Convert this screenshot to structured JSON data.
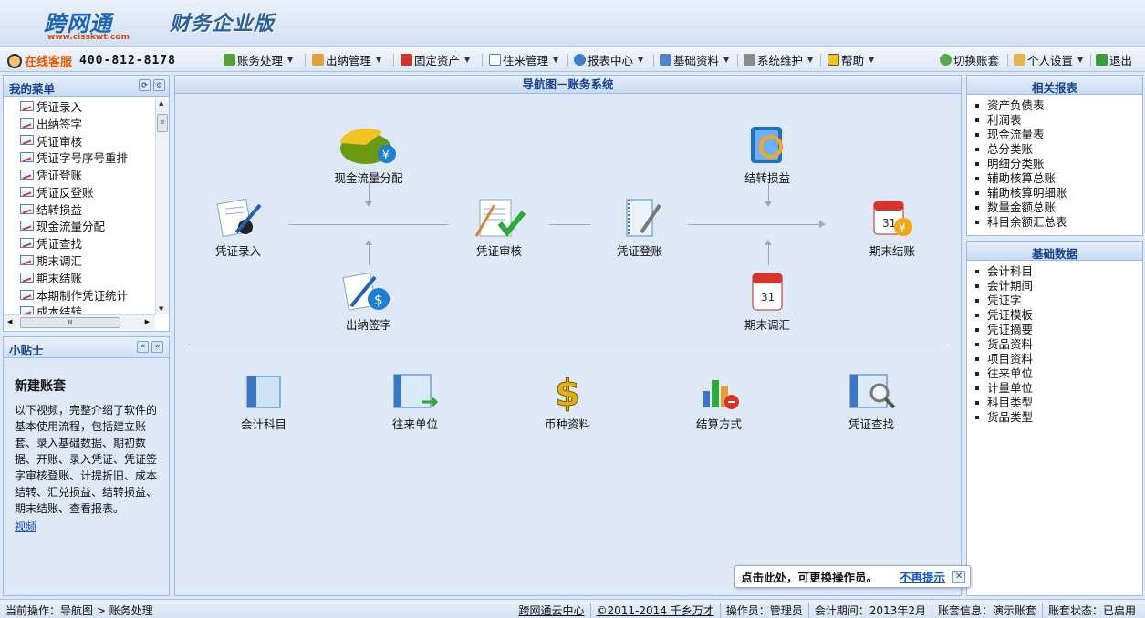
{
  "header": {
    "logo_text": "跨网通",
    "logo_url": "www.cisskwt.com",
    "edition": "财务企业版"
  },
  "hotline": {
    "label": "在线客服",
    "phone": "400-812-8178"
  },
  "toolbar": {
    "menus": [
      {
        "label": "账务处理",
        "icon": "ledger-icon"
      },
      {
        "label": "出纳管理",
        "icon": "cashier-icon"
      },
      {
        "label": "固定资产",
        "icon": "assets-icon"
      },
      {
        "label": "往来管理",
        "icon": "contacts-icon"
      },
      {
        "label": "报表中心",
        "icon": "report-icon"
      },
      {
        "label": "基础资料",
        "icon": "basic-data-icon"
      },
      {
        "label": "系统维护",
        "icon": "tools-icon"
      },
      {
        "label": "帮助",
        "icon": "help-icon"
      }
    ],
    "switch_account": "切换账套",
    "personal_settings": "个人设置",
    "logout": "退出"
  },
  "sidebar": {
    "title": "我的菜单",
    "items": [
      "凭证录入",
      "出纳签字",
      "凭证审核",
      "凭证字号序号重排",
      "凭证登账",
      "凭证反登账",
      "结转损益",
      "现金流量分配",
      "凭证查找",
      "期末调汇",
      "期末结账",
      "本期制作凭证统计",
      "成本结转"
    ]
  },
  "tips": {
    "title": "小贴士",
    "heading": "新建账套",
    "text": "以下视频，完整介绍了软件的基本使用流程，包括建立账套、录入基础数据、期初数据、开账、录入凭证、凭证签字审核登账、计提折旧、成本结转、汇兑损益、结转损益、期末结账、查看报表。",
    "link": "视频"
  },
  "nav": {
    "title": "导航图－账务系统",
    "flow": {
      "cashflow": "现金流量分配",
      "entry": "凭证录入",
      "review": "凭证审核",
      "post": "凭证登账",
      "cashier": "出纳签字",
      "profit": "结转损益",
      "close": "期末结账",
      "exchange": "期末调汇"
    },
    "bottom": [
      "会计科目",
      "往来单位",
      "币种资料",
      "结算方式",
      "凭证查找"
    ]
  },
  "related_reports": {
    "title": "相关报表",
    "items": [
      "资产负债表",
      "利润表",
      "现金流量表",
      "总分类账",
      "明细分类账",
      "辅助核算总账",
      "辅助核算明细账",
      "数量金额总账",
      "科目余额汇总表"
    ]
  },
  "basic_data": {
    "title": "基础数据",
    "items": [
      "会计科目",
      "会计期间",
      "凭证字",
      "凭证模板",
      "凭证摘要",
      "货品资料",
      "项目资料",
      "往来单位",
      "计量单位",
      "科目类型",
      "货品类型"
    ]
  },
  "popup": {
    "text": "点击此处，可更换操作员。",
    "link": "不再提示"
  },
  "status": {
    "current_op": "当前操作：导航图 > 账务处理",
    "cloud": "跨网通云中心",
    "copyright": "©2011-2014 千乡万才",
    "operator": "操作员：管理员",
    "period": "会计期间：2013年2月",
    "account_info": "账套信息：演示账套",
    "account_status": "账套状态：已启用"
  }
}
